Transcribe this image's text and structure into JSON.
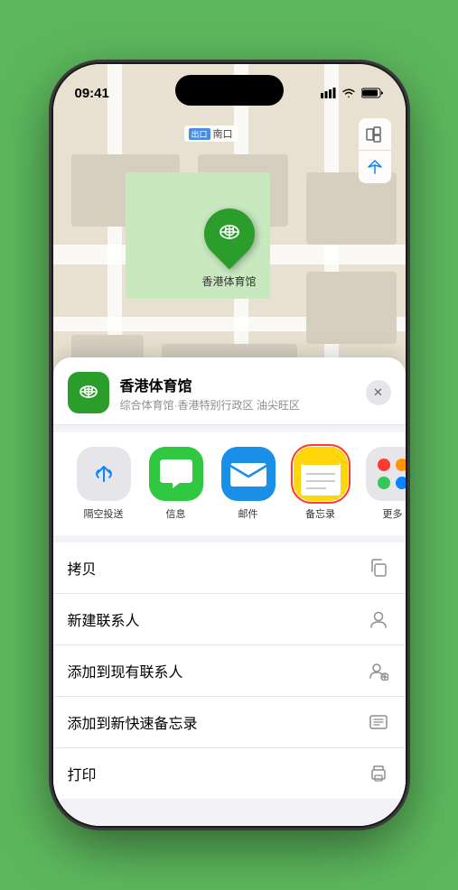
{
  "status_bar": {
    "time": "09:41",
    "signal_icon": "signal-icon",
    "wifi_icon": "wifi-icon",
    "battery_icon": "battery-icon"
  },
  "map": {
    "location_label": "南口",
    "location_badge": "出口",
    "controls": {
      "map_type_icon": "map-type-icon",
      "location_icon": "location-icon"
    },
    "pin": {
      "label": "香港体育馆"
    }
  },
  "sheet": {
    "title": "香港体育馆",
    "subtitle": "综合体育馆·香港特别行政区 油尖旺区",
    "close_label": "✕",
    "share_items": [
      {
        "id": "airdrop",
        "label": "隔空投送",
        "type": "airdrop"
      },
      {
        "id": "messages",
        "label": "信息",
        "type": "messages"
      },
      {
        "id": "mail",
        "label": "邮件",
        "type": "mail"
      },
      {
        "id": "notes",
        "label": "备忘录",
        "type": "notes",
        "highlighted": true
      },
      {
        "id": "more",
        "label": "更多",
        "type": "more"
      }
    ],
    "actions": [
      {
        "id": "copy",
        "label": "拷贝",
        "icon": "copy-icon"
      },
      {
        "id": "new-contact",
        "label": "新建联系人",
        "icon": "new-contact-icon"
      },
      {
        "id": "add-contact",
        "label": "添加到现有联系人",
        "icon": "add-contact-icon"
      },
      {
        "id": "quick-note",
        "label": "添加到新快速备忘录",
        "icon": "quick-note-icon"
      },
      {
        "id": "print",
        "label": "打印",
        "icon": "print-icon"
      }
    ]
  }
}
